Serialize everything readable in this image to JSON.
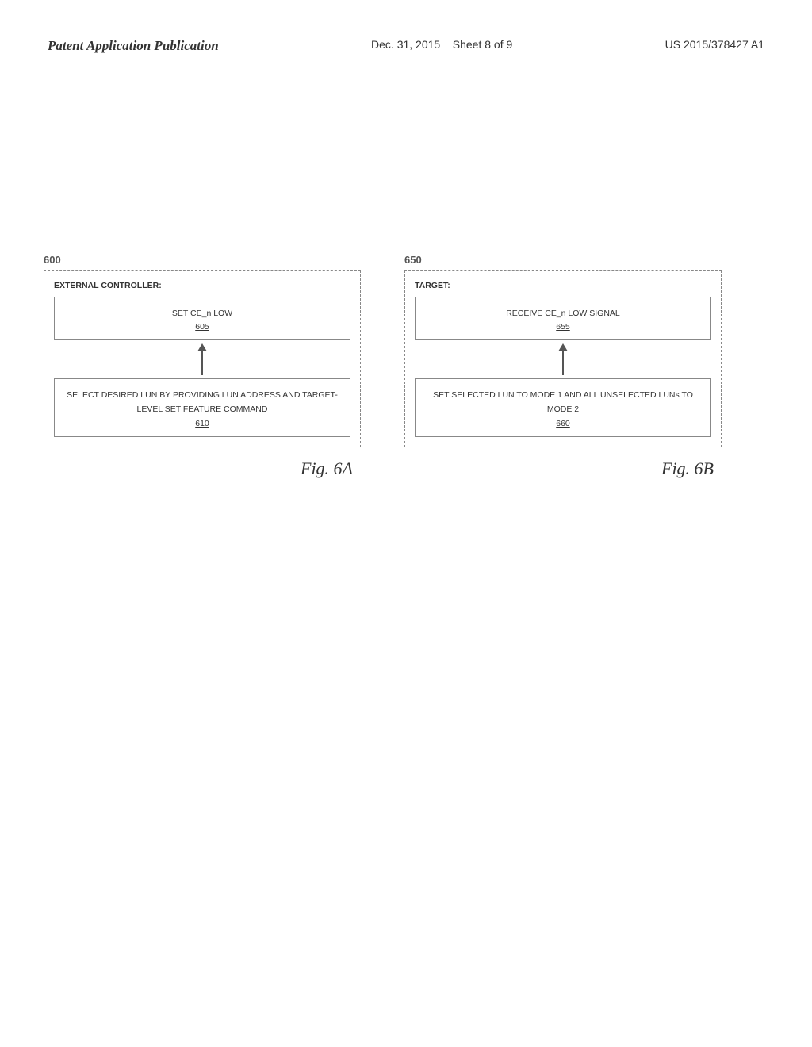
{
  "header": {
    "left": "Patent Application Publication",
    "middle_line1": "Dec. 31, 2015",
    "middle_line2": "Sheet 8 of 9",
    "right": "US 2015/378427 A1"
  },
  "fig6a": {
    "ref_number": "600",
    "figure_label": "Fig. 6A",
    "external_controller_label": "EXTERNAL CONTROLLER:",
    "box_bottom": {
      "text": "SET CE_n LOW",
      "number": "605"
    },
    "box_top": {
      "text": "SELECT DESIRED LUN BY PROVIDING LUN ADDRESS AND TARGET-LEVEL SET FEATURE COMMAND",
      "number": "610"
    }
  },
  "fig6b": {
    "ref_number": "650",
    "figure_label": "Fig. 6B",
    "target_label": "TARGET:",
    "box_bottom": {
      "text": "RECEIVE CE_n LOW SIGNAL",
      "number": "655"
    },
    "box_top": {
      "text": "SET SELECTED LUN TO MODE 1 AND ALL UNSELECTED LUNs TO MODE 2",
      "number": "660"
    }
  }
}
